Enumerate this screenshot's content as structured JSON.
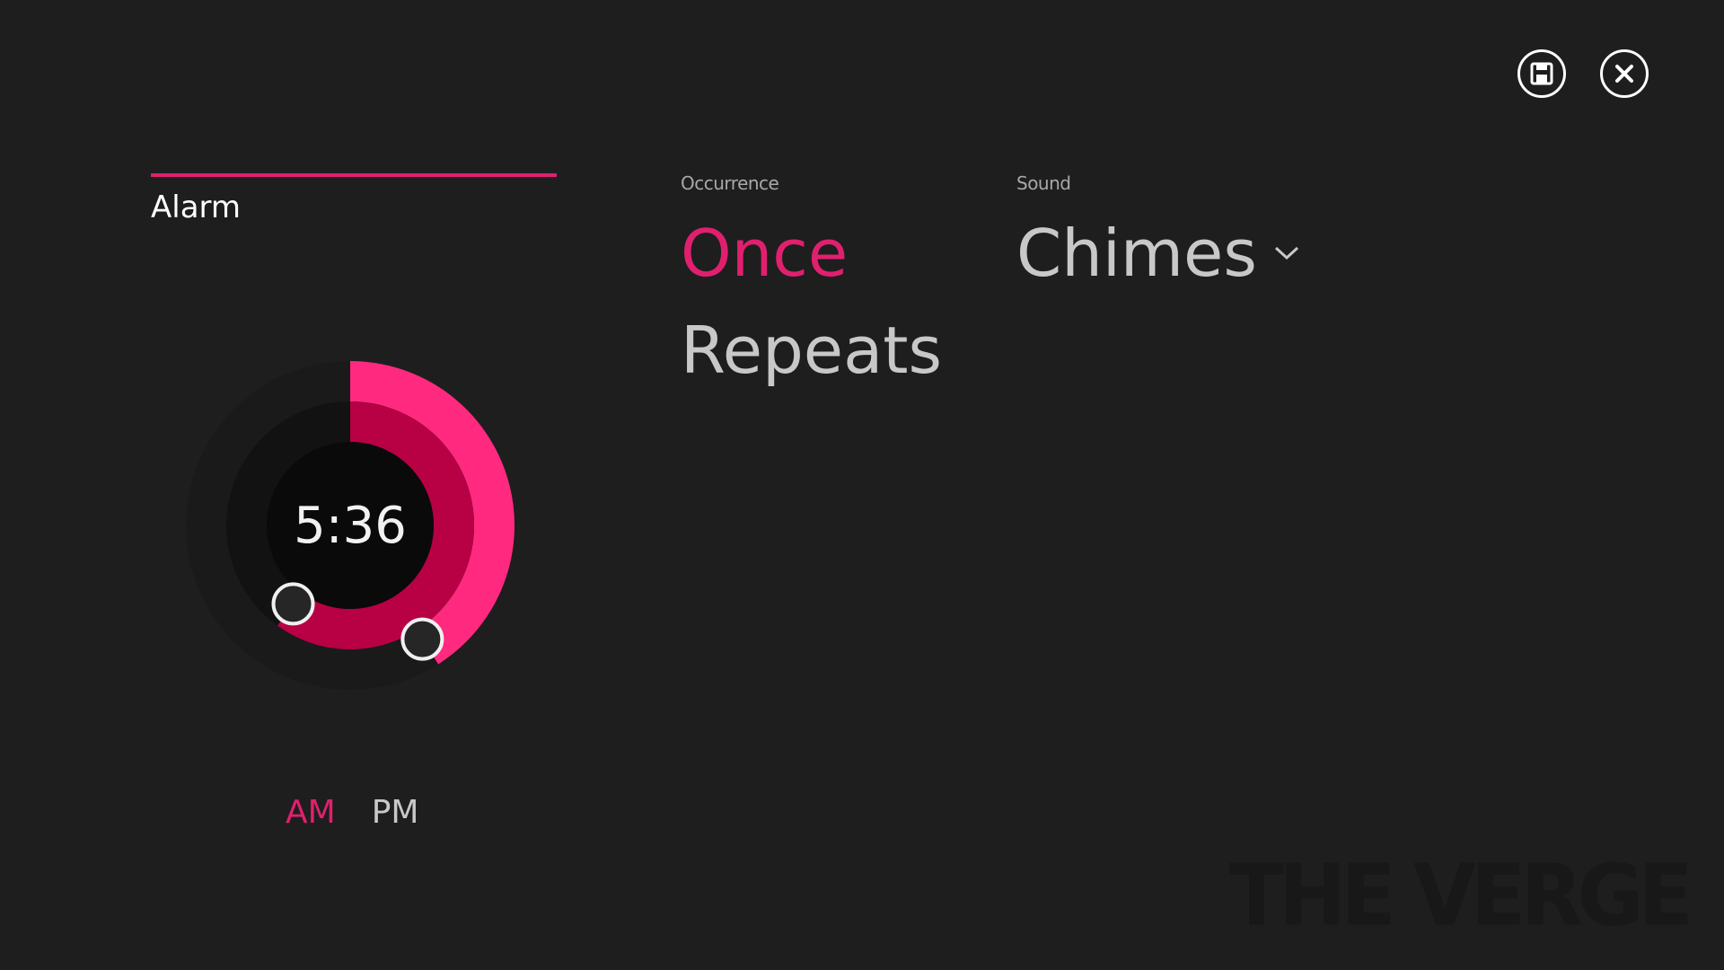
{
  "alarm": {
    "title": "Alarm",
    "time": "5:36",
    "accent_color": "#e0206e",
    "hour_fraction": 0.41,
    "minute_fraction": 0.6
  },
  "meridiem": {
    "am": "AM",
    "pm": "PM",
    "selected": "AM"
  },
  "occurrence": {
    "label": "Occurrence",
    "options": [
      "Once",
      "Repeats"
    ],
    "selected": "Once"
  },
  "sound": {
    "label": "Sound",
    "value": "Chimes"
  },
  "toolbar": {
    "save_icon": "save-icon",
    "close_icon": "close-icon"
  },
  "watermark": "THE VERGE"
}
